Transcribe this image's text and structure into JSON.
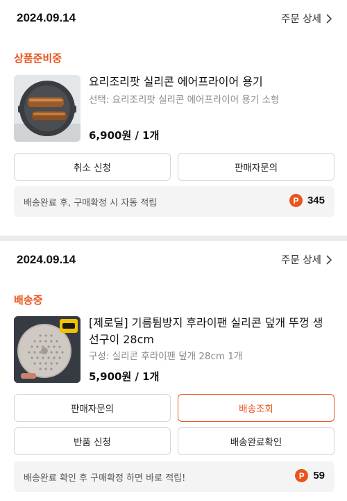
{
  "orders": [
    {
      "date": "2024.09.14",
      "detail_label": "주문 상세",
      "status": "상품준비중",
      "product_name": "요리조리팟 실리콘 에어프라이어 용기",
      "option": "선택: 요리조리팟 실리콘 에어프라이어 용기 소형",
      "price": "6,900원 / 1개",
      "buttons": [
        "취소 신청",
        "판매자문의"
      ],
      "note": "배송완료 후, 구매확정 시 자동 적립",
      "points": "345",
      "point_icon": "P"
    },
    {
      "date": "2024.09.14",
      "detail_label": "주문 상세",
      "status": "배송중",
      "product_name": "[제로딜] 기름튐방지 후라이팬 실리콘 덮개 뚜껑 생선구이 28cm",
      "option": "구성: 실리콘 후라이팬 덮개 28cm 1개",
      "price": "5,900원 / 1개",
      "buttons": [
        "판매자문의",
        "배송조회",
        "반품 신청",
        "배송완료확인"
      ],
      "note": "배송완료 확인 후 구매확정 하면 바로 적립!",
      "points": "59",
      "point_icon": "P"
    }
  ],
  "colors": {
    "accent": "#e8541c",
    "text": "#222222",
    "muted": "#8a8a8a",
    "note_bg": "#f4f4f4"
  }
}
